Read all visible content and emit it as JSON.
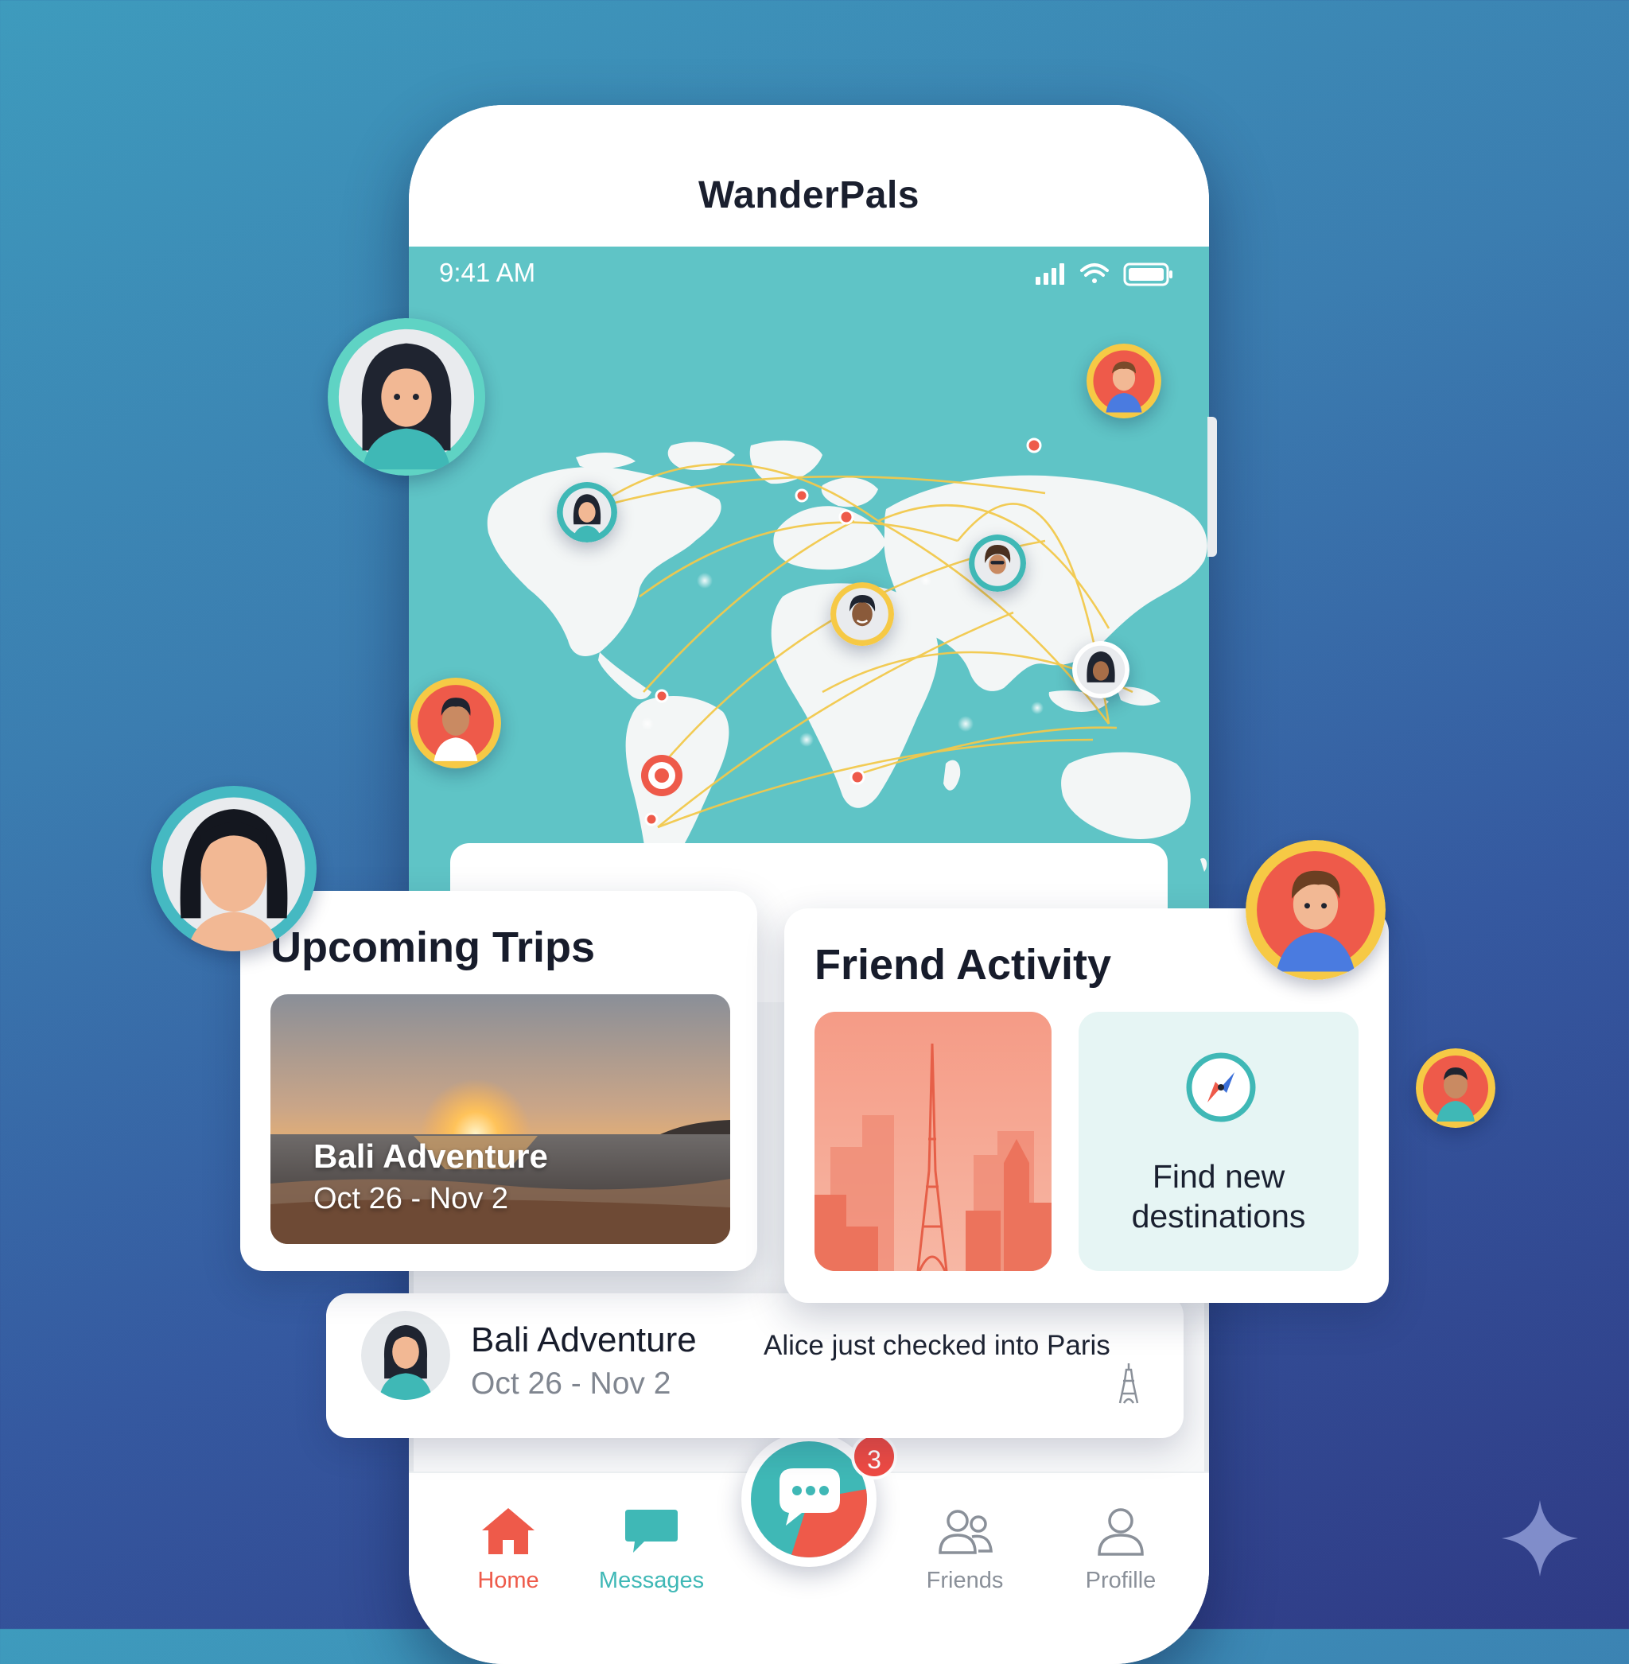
{
  "app": {
    "title": "WanderPals"
  },
  "status_bar": {
    "time": "9:41 AM",
    "icons": [
      "signal-icon",
      "wifi-icon",
      "battery-icon"
    ]
  },
  "upcoming": {
    "heading": "Upcoming Trips",
    "trip_name": "Bali Adventure",
    "trip_dates": "Oct 26 - Nov 2"
  },
  "friend_activity": {
    "heading": "Friend Activity",
    "discover_label": "Find new destinations",
    "feed_text": "Alice just checked into Paris"
  },
  "bottom_panel": {
    "trip_name": "Bali Adventure",
    "trip_dates": "Oct 26 - Nov 2"
  },
  "nav": {
    "items": [
      {
        "label": "Home",
        "icon": "home-icon",
        "active": true
      },
      {
        "label": "Messages",
        "icon": "message-icon"
      },
      {
        "label": "Friends",
        "icon": "friends-icon"
      },
      {
        "label": "Profille",
        "icon": "profile-icon"
      }
    ],
    "chat_badge": "3"
  },
  "colors": {
    "accent_teal": "#3fb8b6",
    "accent_coral": "#ee5a4a",
    "map_sea": "#5fc4c6",
    "avatar_ring_yellow": "#f6c945"
  }
}
